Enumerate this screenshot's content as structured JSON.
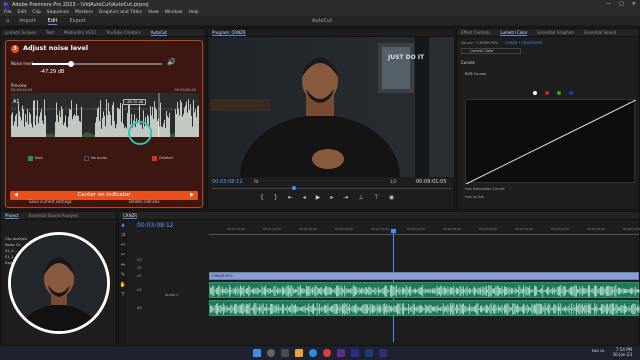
{
  "titlebar": {
    "text": "Adobe Premiere Pro 2023 - \\VidAutoCut\\AutoCut.prproj",
    "app_badge": "Pr",
    "controls": [
      "—",
      "□",
      "✕"
    ]
  },
  "menu": [
    "File",
    "Edit",
    "Clip",
    "Sequence",
    "Markers",
    "Graphics and Titles",
    "View",
    "Window",
    "Help"
  ],
  "workspace": {
    "items": [
      "Import",
      "Edit",
      "Export"
    ],
    "active": "Edit",
    "center": "AutoCut"
  },
  "left_tabs": [
    "Lumetri Scopes",
    "Text",
    "Media Bro VG11",
    "YouTube Creators",
    "AutoCut"
  ],
  "autocut": {
    "step": "3",
    "title": "Adjust noise level",
    "noise_label": "Noise level",
    "noise_value_db": "-47.29 dB",
    "noise_fraction": 0.3,
    "preview_label": "Preview",
    "time_start": "00:03:00:20",
    "time_end": "00:03:02:20",
    "tooltip": "-48.70 dB",
    "track": "A1",
    "legend": [
      {
        "label": "Kept",
        "color": "#2f8f3a"
      },
      {
        "label": "No Audio",
        "color": "#222222"
      },
      {
        "label": "Deleted",
        "color": "#d9302a"
      }
    ],
    "center_button": "Center on indicator",
    "save_label": "Save current settings",
    "delete_label": "Delete silences"
  },
  "program": {
    "title": "Program: CRNZR",
    "timecode": "00:03:08:12",
    "fit": "Fit",
    "quality": "1/2",
    "duration": "00:09:01:05",
    "shirt_text": "JUST DO IT"
  },
  "lumetri": {
    "tabs": [
      "Effect Controls",
      "Lumetri Color",
      "Essential Graphics",
      "Essential Sound"
    ],
    "active_tab": "Lumetri Color",
    "breadcrumb1": "Source • CRNZR.MP4",
    "breadcrumb2": "CRNZR • CRNZR.MP4",
    "fx_label": "Lumetri Color",
    "section": "Curves",
    "sub": "RGB Curves",
    "hue_sat": "Hue Saturation Curves",
    "hue_vs_sat": "Hue vs Sat"
  },
  "project": {
    "tabs": [
      "Project",
      "Essential Sound Analysis"
    ],
    "items": [
      "Clip Analysis",
      "Noise Ch",
      "01_0...",
      "01_1...",
      "Expo..."
    ]
  },
  "timeline": {
    "seq": "CRNZR",
    "timecode": "00:03:08:12",
    "ticks": [
      "00:01:15:00",
      "00:01:30:00",
      "00:01:45:00",
      "00:02:00:00",
      "00:02:15:00",
      "00:02:30:00",
      "00:02:45:00",
      "00:03:00:00",
      "00:03:15:00",
      "00:03:30:00",
      "00:03:45:00",
      "00:04:00:00"
    ],
    "tracks": [
      "V3",
      "V2",
      "V1",
      "A1",
      "A2",
      "A3"
    ],
    "clip_name": "CRNZR.MP4",
    "audio_label": "Audio 1"
  },
  "clock": {
    "time": "7:54 PM",
    "date": "30-Jan-23",
    "lang": "ENG\nIN"
  }
}
